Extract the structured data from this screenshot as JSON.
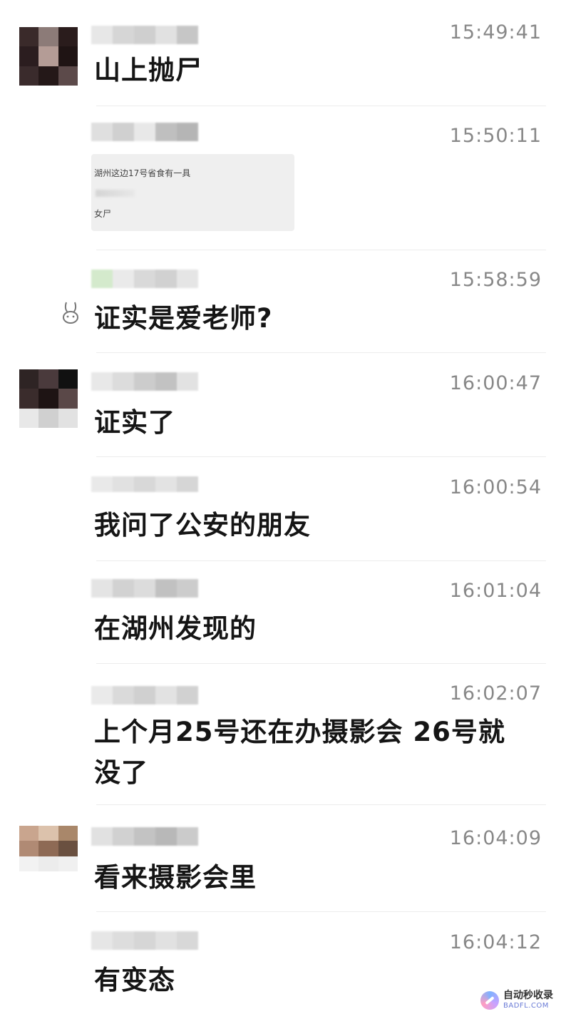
{
  "messages": [
    {
      "time": "15:49:41",
      "text": "山上抛尸"
    },
    {
      "time": "15:50:11",
      "quote_line1": "湖州这边17号省食有一具",
      "quote_line2": "女尸"
    },
    {
      "time": "15:58:59",
      "text": "证实是爱老师?"
    },
    {
      "time": "16:00:47",
      "text": "证实了"
    },
    {
      "time": "16:00:54",
      "text": "我问了公安的朋友"
    },
    {
      "time": "16:01:04",
      "text": "在湖州发现的"
    },
    {
      "time": "16:02:07",
      "text_line1": "上个月25号还在办摄影会 26号就",
      "text_line2": "没了"
    },
    {
      "time": "16:04:09",
      "text": "看来摄影会里"
    },
    {
      "time": "16:04:12",
      "text": "有变态"
    }
  ],
  "icons": {
    "reaction": "rabbit-icon",
    "watermark": "brush-logo-icon"
  },
  "watermark": {
    "main": "自动秒收录",
    "sub": "BADFL.COM"
  }
}
